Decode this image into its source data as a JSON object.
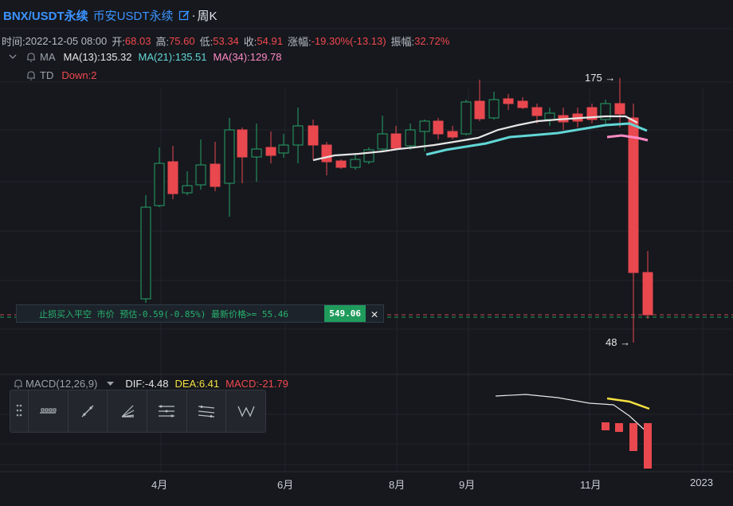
{
  "header": {
    "symbol": "BNX/USDT永续",
    "exchange": "币安USDT永续",
    "separator": "·",
    "interval": "周K"
  },
  "ohlc": {
    "time_label": "时间:",
    "time_value": "2022-12-05 08:00",
    "open_label": "开:",
    "open_value": "68.03",
    "high_label": "高:",
    "high_value": "75.60",
    "low_label": "低:",
    "low_value": "53.34",
    "close_label": "收:",
    "close_value": "54.91",
    "change_label": "涨幅:",
    "change_value": "-19.30%(-13.13)",
    "amp_label": "振幅:",
    "amp_value": "32.72%"
  },
  "ma_indicator": {
    "collapse_icon": "chevron-double-down-icon",
    "name": "MA",
    "ma13": "MA(13):135.32",
    "ma21": "MA(21):135.51",
    "ma34": "MA(34):129.78"
  },
  "td_indicator": {
    "name": "TD",
    "value": "Down:2"
  },
  "price_markers": {
    "high": "175",
    "low": "48",
    "arrow": "→"
  },
  "order": {
    "text": "止损买入平空 市价 预估-0.59(-0.85%) 最新价格>= 55.46",
    "price": "549.06",
    "close": "✕"
  },
  "macd_indicator": {
    "name": "MACD(12,26,9)",
    "dropdown_icon": "triangle-down-icon",
    "dif": "DIF:-4.48",
    "dea": "DEA:6.41",
    "macd": "MACD:-21.79"
  },
  "toolbar": {
    "grip_icon": "drag-grip-icon",
    "tools": [
      "horizontal-ray-tool-icon",
      "trend-line-tool-icon",
      "fan-tool-icon",
      "parallel-channel-tool-icon",
      "regression-channel-tool-icon",
      "pattern-tool-icon"
    ]
  },
  "x_axis": {
    "labels": [
      "4月",
      "6月",
      "8月",
      "9月",
      "11月",
      "2023"
    ]
  },
  "colors": {
    "up": "#26a269",
    "down": "#e8484e",
    "accent": "#3b93ff",
    "ma13": "#e6e6e6",
    "ma21": "#62d6d6",
    "ma34": "#ff8ac4",
    "dea": "#f5e042"
  }
}
